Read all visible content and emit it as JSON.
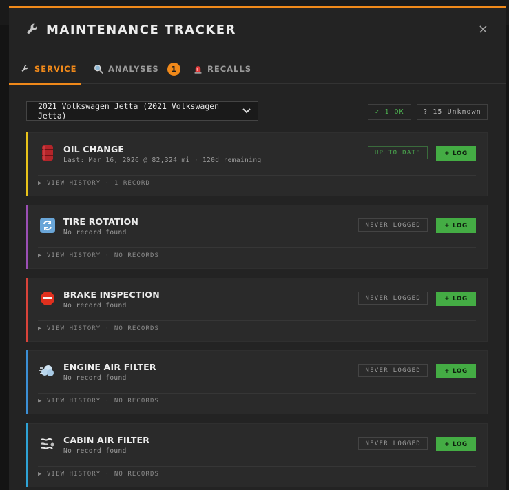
{
  "header": {
    "title": "MAINTENANCE TRACKER",
    "close_label": "×"
  },
  "tabs": [
    {
      "label": "SERVICE",
      "icon": "wrench-icon",
      "active": true
    },
    {
      "label": "ANALYSES",
      "icon": "magnifier-icon",
      "badge": "1"
    },
    {
      "label": "RECALLS",
      "icon": "alarm-light-icon"
    }
  ],
  "vehicle": {
    "selected": "2021 Volkswagen Jetta (2021 Volkswagen Jetta)",
    "chevron": "⌄"
  },
  "summary": {
    "ok": "✓ 1 OK",
    "unknown": "? 15 Unknown"
  },
  "colors": {
    "accent": "#f0891a",
    "ok_green": "#4caf50",
    "log_button": "#44ac44"
  },
  "log_label": "+ LOG",
  "services": [
    {
      "name": "OIL CHANGE",
      "icon": "oil-barrel-icon",
      "accent": "#e8c31a",
      "sub": "Last: Mar 16, 2026 @ 82,324 mi · 120d remaining",
      "status": "UP TO DATE",
      "status_good": true,
      "history": "▶ VIEW HISTORY · 1 RECORD"
    },
    {
      "name": "TIRE ROTATION",
      "icon": "rotate-arrows-icon",
      "accent": "#9b4fb5",
      "sub": "No record found",
      "status": "NEVER LOGGED",
      "history": "▶ VIEW HISTORY · NO RECORDS"
    },
    {
      "name": "BRAKE INSPECTION",
      "icon": "stop-sign-icon",
      "accent": "#d9433a",
      "sub": "No record found",
      "status": "NEVER LOGGED",
      "history": "▶ VIEW HISTORY · NO RECORDS"
    },
    {
      "name": "ENGINE AIR FILTER",
      "icon": "air-puff-icon",
      "accent": "#3b8fd6",
      "sub": "No record found",
      "status": "NEVER LOGGED",
      "history": "▶ VIEW HISTORY · NO RECORDS"
    },
    {
      "name": "CABIN AIR FILTER",
      "icon": "wind-icon",
      "accent": "#2ea3d6",
      "sub": "No record found",
      "status": "NEVER LOGGED",
      "history": "▶ VIEW HISTORY · NO RECORDS"
    }
  ]
}
